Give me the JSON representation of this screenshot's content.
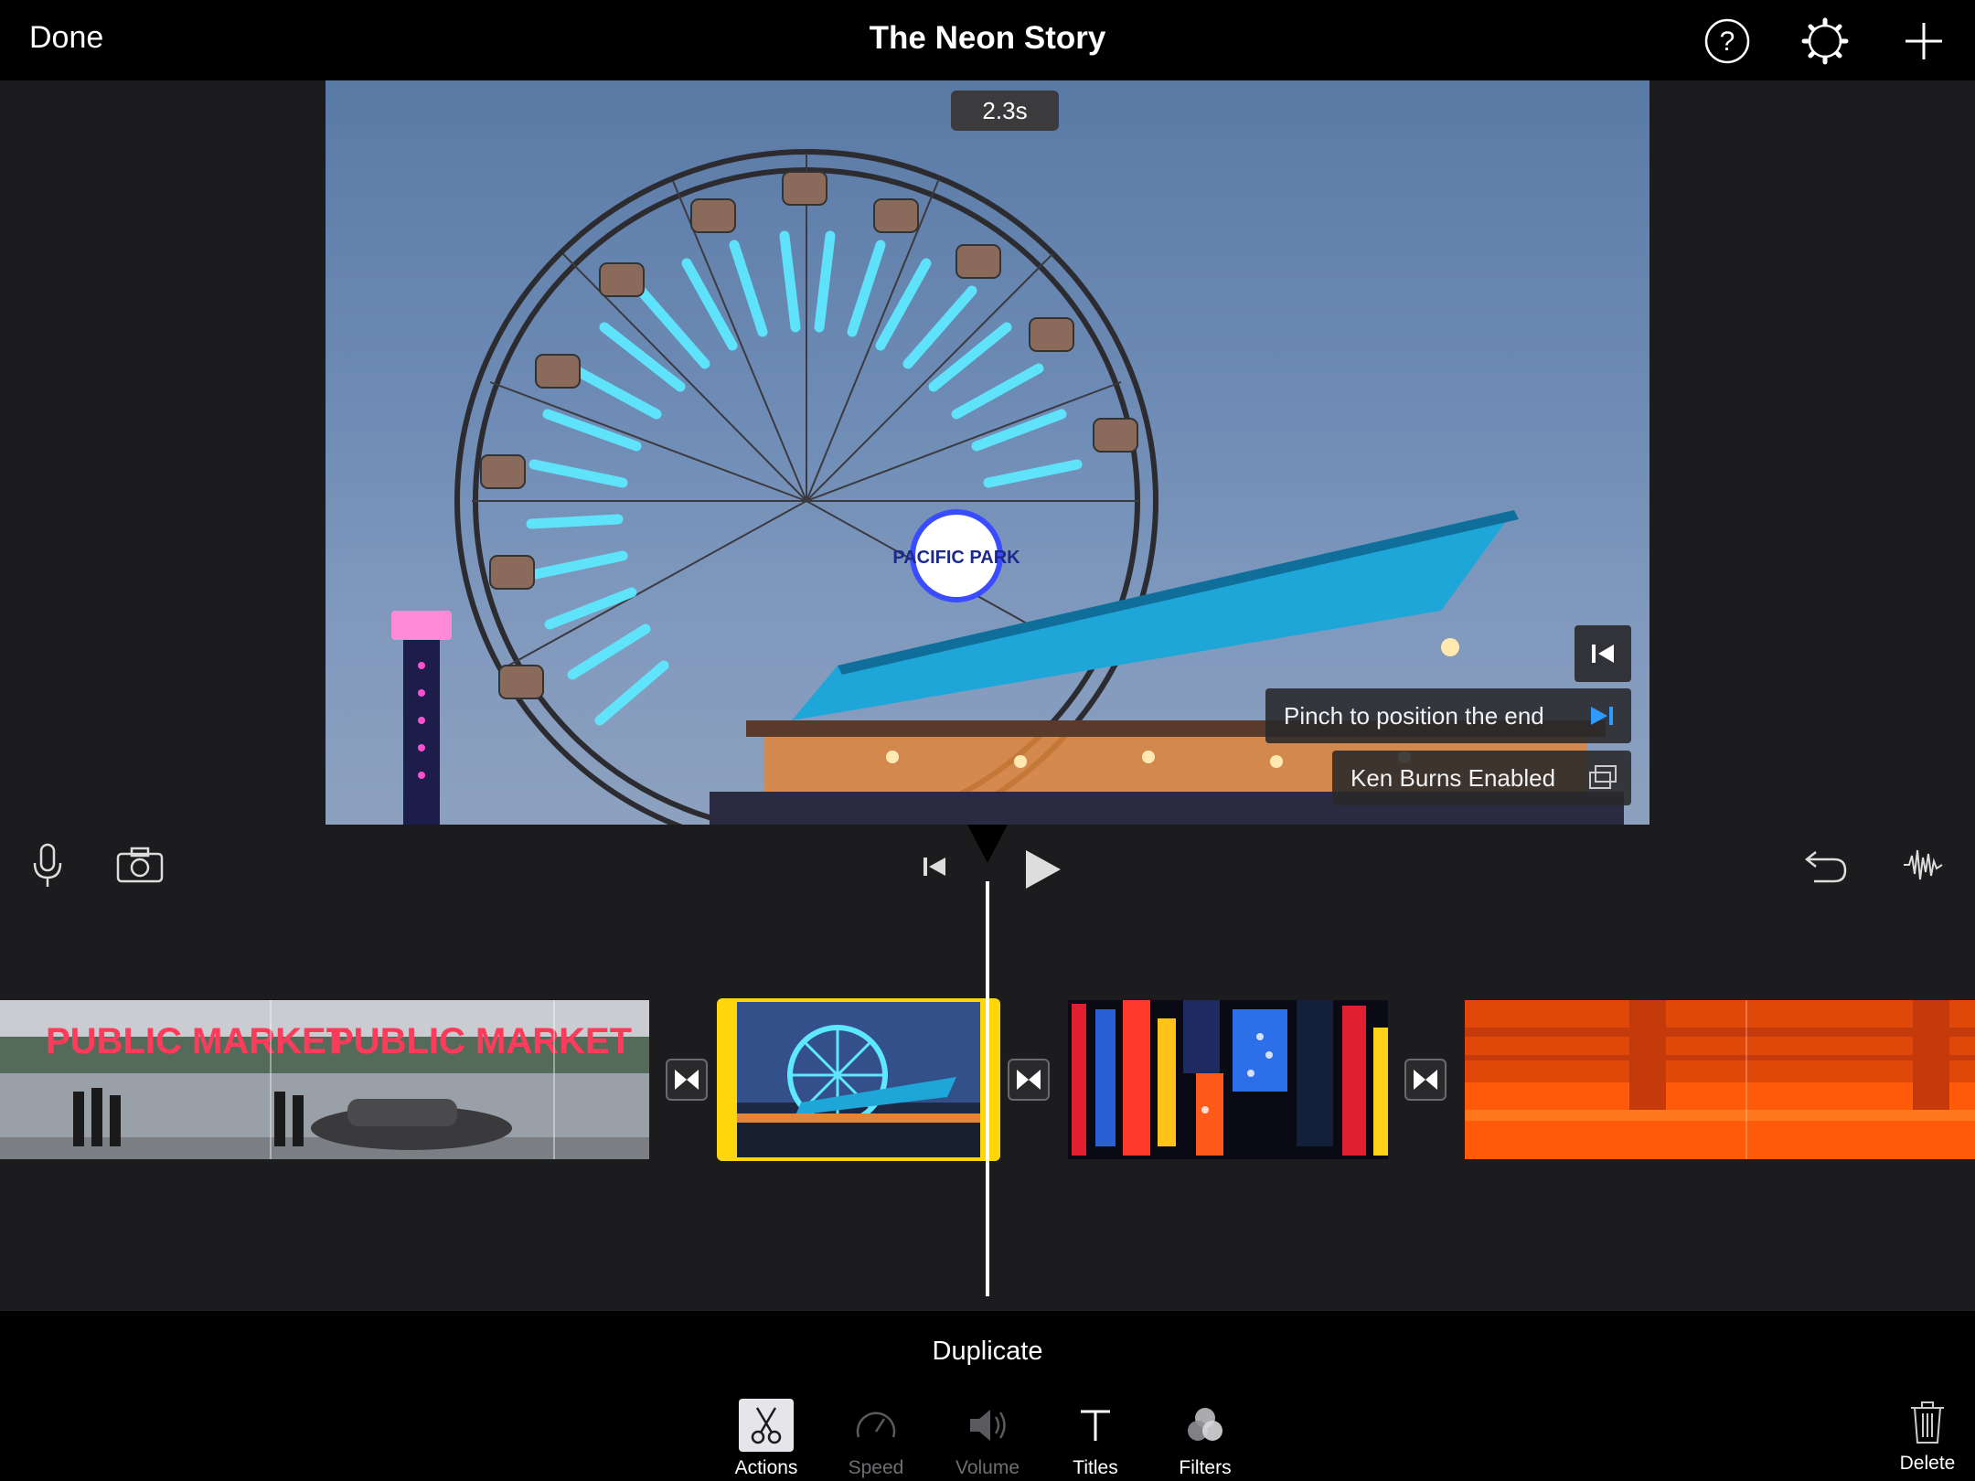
{
  "header": {
    "done_label": "Done",
    "title": "The Neon Story",
    "icons": [
      "help-icon",
      "settings-gear-icon",
      "add-plus-icon"
    ]
  },
  "viewer": {
    "duration_badge": "2.3s",
    "pinch_hint": "Pinch to position the end",
    "ken_burns_label": "Ken Burns Enabled",
    "sign_text": "PACIFIC PARK"
  },
  "toolbar": {
    "left_icons": [
      "microphone-icon",
      "camera-icon"
    ],
    "center_icons": [
      "skip-to-start-icon",
      "play-icon"
    ],
    "right_icons": [
      "undo-icon",
      "audio-waveform-icon"
    ]
  },
  "timeline": {
    "clips": [
      {
        "name": "public-market",
        "sign_text": "PUBLIC MARKET"
      },
      {
        "name": "ferris-wheel",
        "selected": true
      },
      {
        "name": "neon-signs"
      },
      {
        "name": "orange-machinery"
      }
    ],
    "accent_color": "#ffd60a"
  },
  "bottom": {
    "action_label": "Duplicate",
    "tabs": [
      {
        "label": "Actions",
        "state": "active"
      },
      {
        "label": "Speed",
        "state": "disabled"
      },
      {
        "label": "Volume",
        "state": "disabled"
      },
      {
        "label": "Titles",
        "state": "enabled"
      },
      {
        "label": "Filters",
        "state": "enabled"
      }
    ],
    "delete_label": "Delete"
  }
}
